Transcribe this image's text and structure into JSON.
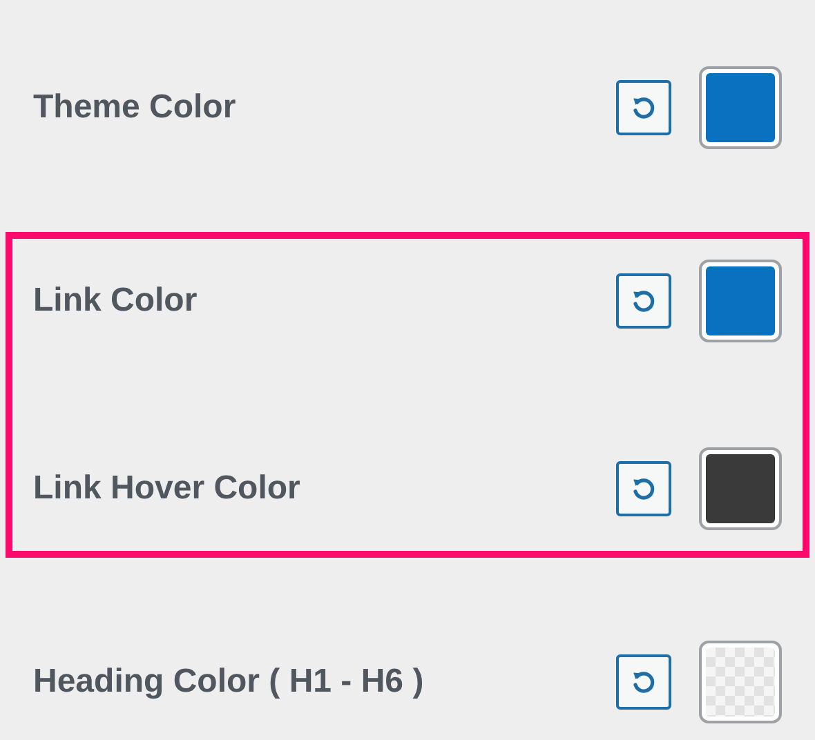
{
  "groups": [
    {
      "highlighted": false,
      "settings": [
        {
          "label": "Theme Color",
          "kind": "solid",
          "color": "#0a71c1"
        }
      ]
    },
    {
      "highlighted": true,
      "settings": [
        {
          "label": "Link Color",
          "kind": "solid",
          "color": "#0a71c1"
        },
        {
          "label": "Link Hover Color",
          "kind": "solid",
          "color": "#3a3a3a"
        }
      ]
    },
    {
      "highlighted": false,
      "settings": [
        {
          "label": "Heading Color ( H1 - H6 )",
          "kind": "transparent"
        }
      ]
    }
  ]
}
